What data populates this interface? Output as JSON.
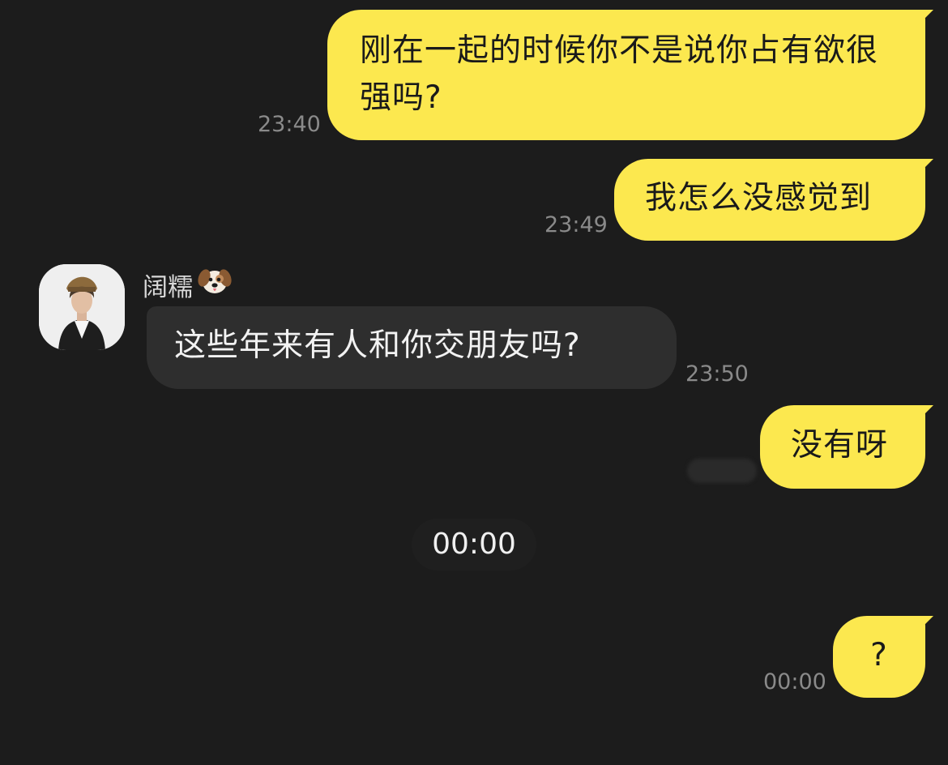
{
  "messages": {
    "m1": {
      "text": "刚在一起的时候你不是说你占有欲很强吗?",
      "time": "23:40"
    },
    "m2": {
      "text": "我怎么没感觉到",
      "time": "23:49"
    },
    "m3": {
      "sender": "阔糯",
      "text": "这些年来有人和你交朋友吗?",
      "time": "23:50"
    },
    "m4": {
      "text": "没有呀"
    },
    "divider_time": "00:00",
    "m5": {
      "text": "?",
      "time": "00:00"
    }
  },
  "colors": {
    "background": "#1c1c1c",
    "outgoing_bubble": "#fce84f",
    "incoming_bubble": "#2e2e2e",
    "timestamp": "#8a8a8a"
  },
  "icons": {
    "sender_badge": "dog-face-icon"
  }
}
